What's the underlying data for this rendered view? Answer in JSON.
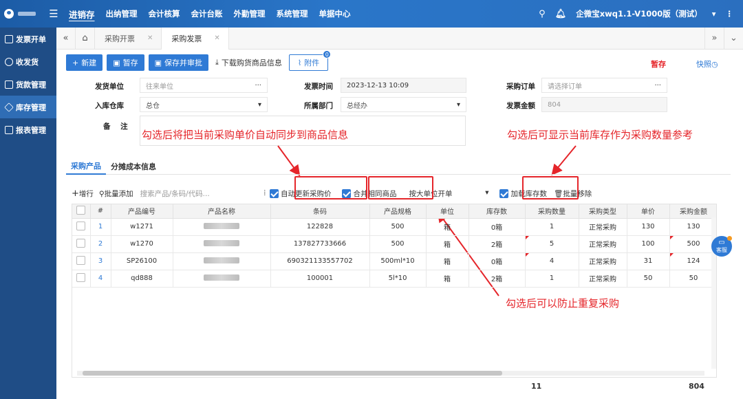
{
  "topbar": {
    "nav": [
      "进销存",
      "出纳管理",
      "会计核算",
      "会计台账",
      "外勤管理",
      "系统管理",
      "单据中心"
    ],
    "account": "企微宝xwq1.1-V1000版（测试）"
  },
  "sidebar": {
    "items": [
      "发票开单",
      "收发货",
      "货款管理",
      "库存管理",
      "报表管理"
    ]
  },
  "tabs": [
    "采购开票",
    "采购发票"
  ],
  "toolbar": {
    "new": "新建",
    "draft": "暂存",
    "save_approve": "保存并审批",
    "download": "下载购货商品信息",
    "attachment": "附件",
    "attachment_count": "0",
    "status": "暂存",
    "snapshot": "快照"
  },
  "form": {
    "supplier_label": "发货单位",
    "supplier_placeholder": "往来单位",
    "time_label": "发票时间",
    "time_value": "2023-12-13 10:09",
    "order_label": "采购订单",
    "order_placeholder": "请选择订单",
    "warehouse_label": "入库仓库",
    "warehouse_value": "总仓",
    "dept_label": "所属部门",
    "dept_value": "总经办",
    "amount_label": "发票金额",
    "amount_value": "804",
    "remark_label": "备    注"
  },
  "annotations": {
    "auto_update": "勾选后将把当前采购单价自动同步到商品信息",
    "load_stock": "勾选后可显示当前库存作为采购数量参考",
    "merge": "勾选后可以防止重复采购"
  },
  "section_tabs": [
    "采购产品",
    "分摊成本信息"
  ],
  "grid_toolbar": {
    "add_row": "增行",
    "batch_add": "批量添加",
    "search_placeholder": "搜索产品/条码/代码...",
    "auto_update": "自动更新采购价",
    "merge": "合并相同商品",
    "unit_select": "按大单位开单",
    "load_stock": "加载库存数",
    "batch_remove": "批量移除"
  },
  "table": {
    "headers": [
      "#",
      "产品编号",
      "产品名称",
      "条码",
      "产品规格",
      "单位",
      "库存数",
      "采购数量",
      "采购类型",
      "单价",
      "采购金额"
    ],
    "rows": [
      {
        "idx": "1",
        "code": "w1271",
        "barcode": "122828",
        "spec": "500",
        "unit": "箱",
        "stock": "0箱",
        "qty": "1",
        "type": "正常采购",
        "price": "130",
        "amount": "130"
      },
      {
        "idx": "2",
        "code": "w1270",
        "barcode": "137827733666",
        "spec": "500",
        "unit": "箱",
        "stock": "2箱",
        "qty": "5",
        "type": "正常采购",
        "price": "100",
        "amount": "500"
      },
      {
        "idx": "3",
        "code": "SP26100",
        "barcode": "690321133557702",
        "spec": "500ml*10",
        "unit": "箱",
        "stock": "0箱",
        "qty": "4",
        "type": "正常采购",
        "price": "31",
        "amount": "124"
      },
      {
        "idx": "4",
        "code": "qd888",
        "barcode": "100001",
        "spec": "5l*10",
        "unit": "箱",
        "stock": "2箱",
        "qty": "1",
        "type": "正常采购",
        "price": "50",
        "amount": "50"
      }
    ],
    "total_qty": "11",
    "total_amount": "804"
  },
  "service": "客服"
}
